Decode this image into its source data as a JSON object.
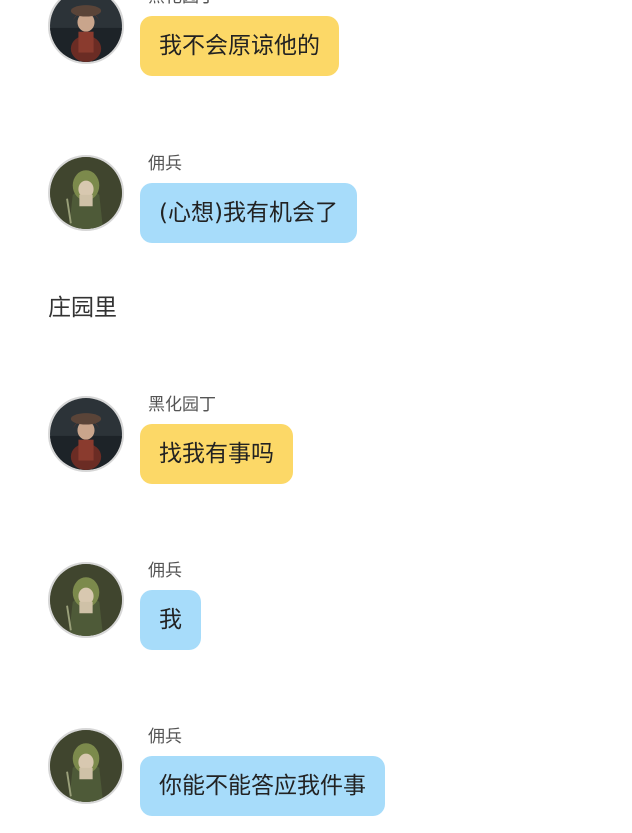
{
  "messages": [
    {
      "sender": "黑化园丁",
      "text": "我不会原谅他的",
      "role": "gardener",
      "avatar_icon": "gardener-avatar-icon",
      "bubble_color": "#fcd867"
    },
    {
      "sender": "佣兵",
      "text": "(心想)我有机会了",
      "role": "mercenary",
      "avatar_icon": "mercenary-avatar-icon",
      "bubble_color": "#a7dcfa"
    },
    {
      "sender": "黑化园丁",
      "text": "找我有事吗",
      "role": "gardener",
      "avatar_icon": "gardener-avatar-icon",
      "bubble_color": "#fcd867"
    },
    {
      "sender": "佣兵",
      "text": "我",
      "role": "mercenary",
      "avatar_icon": "mercenary-avatar-icon",
      "bubble_color": "#a7dcfa"
    },
    {
      "sender": "佣兵",
      "text": "你能不能答应我件事",
      "role": "mercenary",
      "avatar_icon": "mercenary-avatar-icon",
      "bubble_color": "#a7dcfa"
    }
  ],
  "narration": "庄园里"
}
